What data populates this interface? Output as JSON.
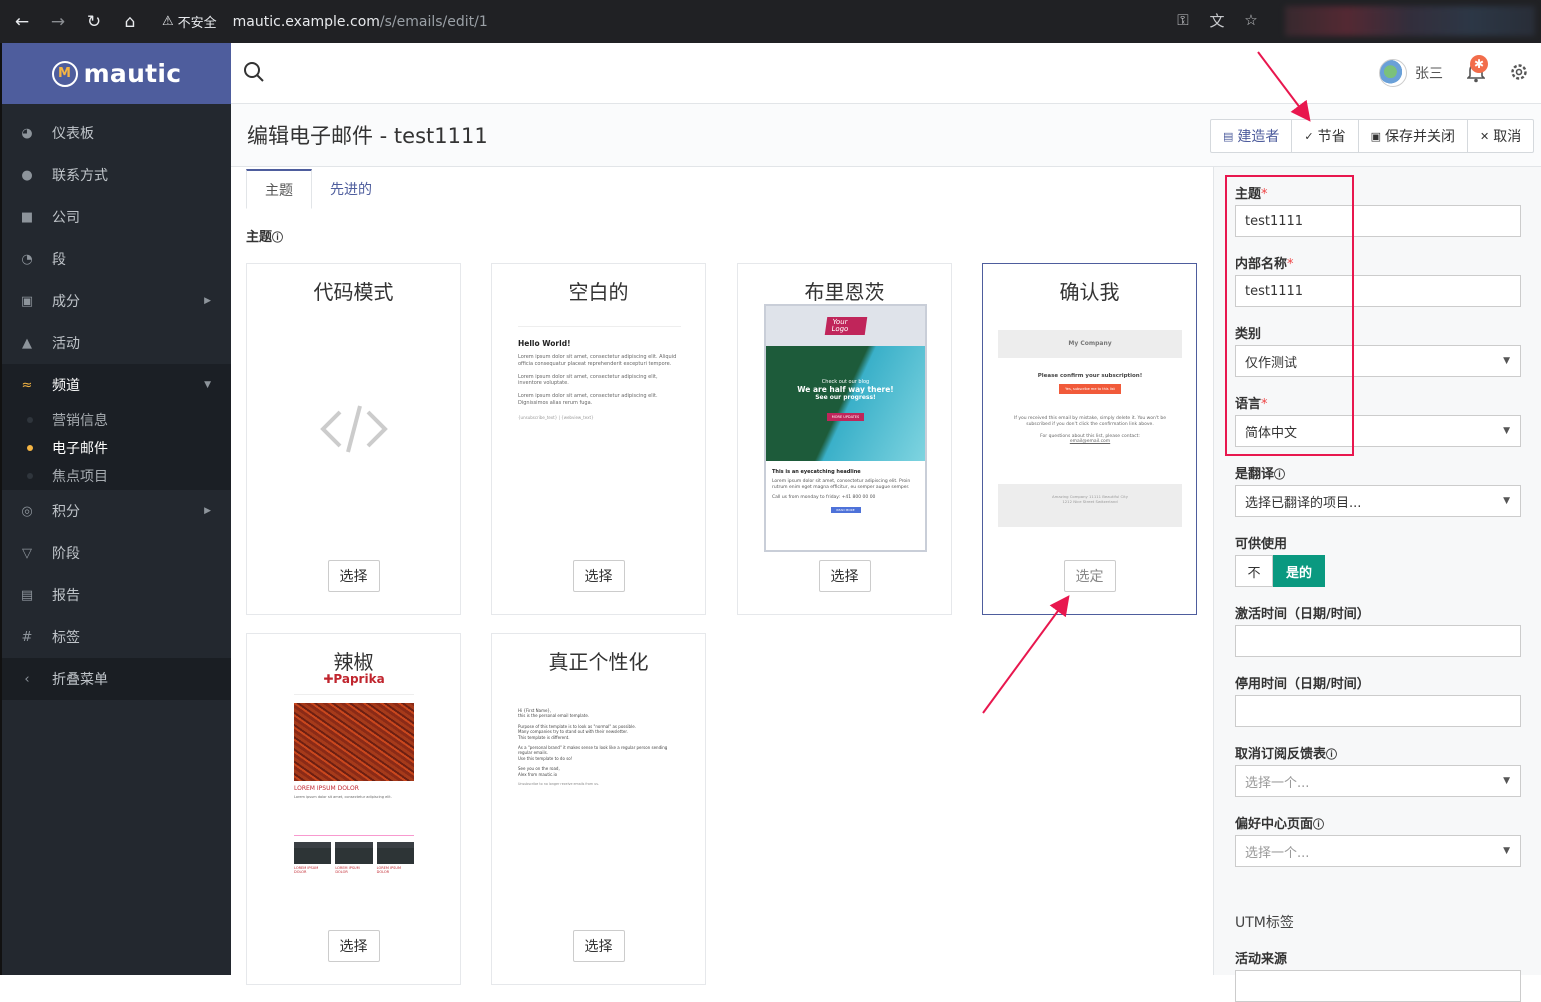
{
  "browser": {
    "insecure_label": "不安全",
    "url_host": "mautic.example.com",
    "url_path": "/s/emails/edit/1"
  },
  "app": {
    "logo_text": "mautic"
  },
  "sidebar": {
    "items": [
      {
        "label": "仪表板",
        "icon": "dashboard-icon"
      },
      {
        "label": "联系方式",
        "icon": "user-icon"
      },
      {
        "label": "公司",
        "icon": "building-icon"
      },
      {
        "label": "段",
        "icon": "pie-icon"
      },
      {
        "label": "成分",
        "icon": "puzzle-icon"
      },
      {
        "label": "活动",
        "icon": "bullhorn-icon"
      },
      {
        "label": "频道",
        "icon": "rss-icon"
      },
      {
        "label": "积分",
        "icon": "target-icon"
      },
      {
        "label": "阶段",
        "icon": "filter-icon"
      },
      {
        "label": "报告",
        "icon": "report-icon"
      },
      {
        "label": "标签",
        "icon": "hash-icon"
      }
    ],
    "channel_sub": [
      "营销信息",
      "电子邮件",
      "焦点项目"
    ],
    "collapse_label": "折叠菜单"
  },
  "header": {
    "user_name": "张三",
    "notification_badge": "✱"
  },
  "page": {
    "title": "编辑电子邮件 - test1111",
    "buttons": {
      "builder": "建造者",
      "save": "节省",
      "save_close": "保存并关闭",
      "cancel": "取消"
    },
    "tabs": [
      "主题",
      "先进的"
    ],
    "theme_section_label": "主题"
  },
  "themes": [
    {
      "title": "代码模式",
      "button": "选择"
    },
    {
      "title": "空白的",
      "button": "选择"
    },
    {
      "title": "布里恩茨",
      "button": "选择"
    },
    {
      "title": "确认我",
      "button": "选定"
    },
    {
      "title": "辣椒",
      "button": "选择"
    },
    {
      "title": "真正个性化",
      "button": "选择"
    }
  ],
  "thumbs": {
    "blank": {
      "heading": "Hello World!",
      "line1": "Lorem ipsum dolor sit amet, consectetur adipiscing elit. Aliquid officia consequatur placeat reprehenderit excepturi tempore.",
      "line2": "Lorem ipsum dolor sit amet, consectetur adipiscing elit, inventore voluptate.",
      "line3": "Lorem ipsum dolor sit amet, consectetur adipiscing elit. Dignissimos alias rerum fuga.",
      "footer": "{unsubscribe_text} | {webview_text}"
    },
    "brienz": {
      "logo": "Your Logo",
      "hero1": "Check out our blog",
      "hero2": "We are half way there!",
      "hero3": "See our progress!",
      "cta": "MORE UPDATES",
      "headline": "This is an eyecatching headline",
      "body": "Lorem ipsum dolor sit amet, consectetur adipiscing elit. Proin rutrum enim eget magna efficitur, eu semper augue semper.",
      "contact": "Call us from monday to friday: +41 800 00 00",
      "readmore": "READ MORE"
    },
    "confirm": {
      "company": "My Company",
      "msg": "Please confirm your subscription!",
      "cta": "Yes, subscribe me to this list",
      "note": "If you received this email by mistake, simply delete it. You won't be subscribed if you don't click the confirmation link above.",
      "contact": "For questions about this list, please contact:",
      "email": "email@email.com",
      "footer": "Amazing Company 11111 Beautiful City 1212 Nice Street Switzerland"
    },
    "paprika": {
      "brand": "Paprika",
      "heading": "LOREM IPSUM DOLOR",
      "body": "Lorem ipsum dolor sit amet, consectetur adipiscing elit.",
      "col": "LOREM IPSUM DOLOR"
    },
    "personal": {
      "l1": "Hi {First Name},",
      "l2": "this is the personal email template.",
      "l3": "Purpose of this template is to look as \"normal\" as possible.",
      "l4": "Many companies try to stand out with their newsletter.",
      "l5": "This template is different.",
      "l6": "As a \"personal brand\" it makes sense to look like a regular person sending regular emails.",
      "l7": "Use this template to do so!",
      "l8": "See you on the road,",
      "l9": "Alex from mautic.io",
      "l10": "Unsubscribe to no longer receive emails from us."
    }
  },
  "form": {
    "subject_label": "主题",
    "subject_value": "test1111",
    "name_label": "内部名称",
    "name_value": "test1111",
    "category_label": "类别",
    "category_value": "仅作测试",
    "language_label": "语言",
    "language_value": "简体中文",
    "translation_label": "是翻译",
    "translation_placeholder": "选择已翻译的项目...",
    "published_label": "可供使用",
    "published_no": "不",
    "published_yes": "是的",
    "publish_up_label": "激活时间（日期/时间）",
    "publish_down_label": "停用时间（日期/时间）",
    "unsub_form_label": "取消订阅反馈表",
    "unsub_form_placeholder": "选择一个...",
    "pref_center_label": "偏好中心页面",
    "pref_center_placeholder": "选择一个...",
    "utm_label": "UTM标签",
    "utm_source_label": "活动来源"
  },
  "colors": {
    "brand": "#4e5d9d",
    "accent": "#f5b544",
    "annotation": "#e8174e",
    "toggle_on": "#0a9980"
  }
}
